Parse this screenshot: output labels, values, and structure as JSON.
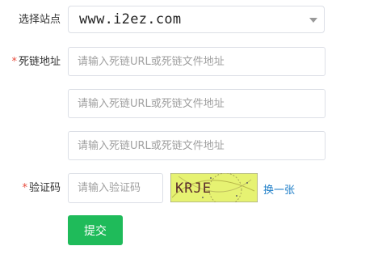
{
  "form": {
    "site": {
      "label": "选择站点",
      "selected": "www.i2ez.com"
    },
    "dead_link": {
      "label": "死链地址",
      "required_mark": "*",
      "placeholders": [
        "请输入死链URL或死链文件地址",
        "请输入死链URL或死链文件地址",
        "请输入死链URL或死链文件地址"
      ]
    },
    "captcha": {
      "label": "验证码",
      "required_mark": "*",
      "placeholder": "请输入验证码",
      "image_text": "KRJE",
      "refresh_label": "换一张"
    },
    "submit_label": "提交"
  },
  "colors": {
    "accent": "#1fbb5a",
    "link": "#1e7ec8",
    "required": "#e84c3d",
    "captcha_bg": "#e6f272"
  },
  "icons": {
    "select_caret": "caret-down-icon"
  }
}
